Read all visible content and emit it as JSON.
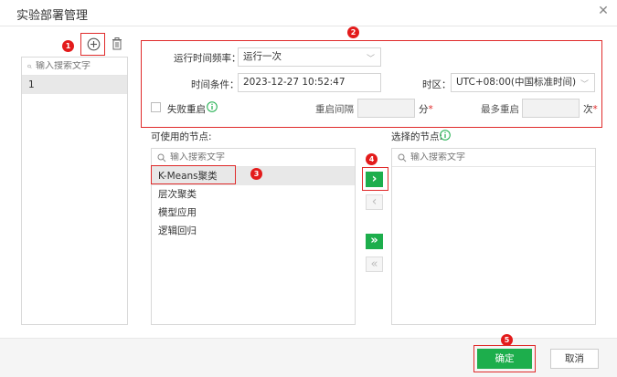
{
  "dialog": {
    "title": "实验部署管理"
  },
  "left_panel": {
    "search_placeholder": "输入搜索文字",
    "items": [
      "1"
    ]
  },
  "schedule": {
    "frequency_label": "运行时间频率：",
    "frequency_value": "运行一次",
    "time_label": "时间条件：",
    "time_value": "2023-12-27 10:52:47",
    "timezone_label": "时区：",
    "timezone_value": "UTC+08:00(中国标准时间)",
    "retry_label": "失败重启",
    "interval_label": "重启间隔",
    "interval_unit": "分",
    "max_label": "最多重启",
    "max_unit": "次",
    "required_mark": "*"
  },
  "available_nodes": {
    "label": "可使用的节点:",
    "search_placeholder": "输入搜索文字",
    "items": [
      "K-Means聚类",
      "层次聚类",
      "模型应用",
      "逻辑回归"
    ]
  },
  "selected_nodes": {
    "label": "选择的节点:",
    "search_placeholder": "输入搜索文字"
  },
  "transfer": {
    "move_right": "›",
    "move_left": "‹",
    "move_all_right": "»",
    "move_all_left": "«"
  },
  "footer": {
    "ok_label": "确定",
    "cancel_label": "取消"
  },
  "badges": [
    "1",
    "2",
    "3",
    "4",
    "5"
  ],
  "colors": {
    "accent": "#1dae4c",
    "annotation": "#e02b2b",
    "info": "#1dae4c"
  }
}
